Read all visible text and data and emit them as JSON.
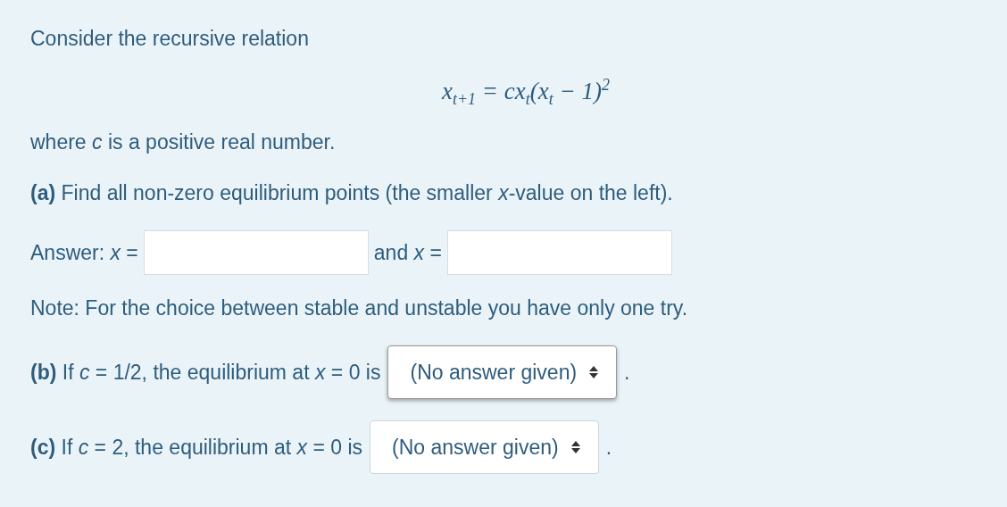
{
  "intro": "Consider the recursive relation",
  "equation": "x$_{t+1}$ = cx$_{t}$(x$_{t}$ − 1)$^{2}$",
  "condition": "where *c* is a positive real number.",
  "part_a": {
    "text": "**(a)** Find all non-zero equilibrium points (the smaller *x*-value on the left).",
    "answer_label": "Answer: *x* =",
    "and_label": "and *x* ="
  },
  "note": "Note: For the choice between stable and unstable you have only one try.",
  "choices": [
    {
      "text": "**(b)**  If *c* = 1/2, the equilibrium at *x* = 0 is",
      "select": "(No answer given)",
      "focused": true,
      "end": "."
    },
    {
      "text": "**(c)** If *c* = 2, the equilibrium at *x* = 0 is",
      "select": "(No answer given)",
      "focused": false,
      "end": "."
    }
  ]
}
